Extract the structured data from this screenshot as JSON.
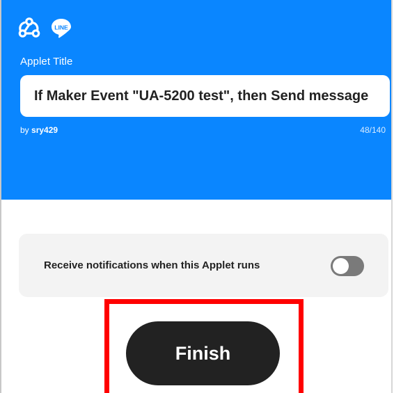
{
  "header": {
    "background_color": "#0a86ff",
    "service_icons": [
      "webhooks-icon",
      "line-icon"
    ],
    "line_icon_text": "LINE",
    "line_icon_color": "#ffffff"
  },
  "applet": {
    "title_label": "Applet Title",
    "title_value": "If Maker Event \"UA-5200 test\", then Send message",
    "author_prefix": "by",
    "author_name": "sry429",
    "char_count": "48/140"
  },
  "notifications": {
    "label": "Receive notifications when this Applet runs",
    "enabled": false
  },
  "actions": {
    "finish_label": "Finish",
    "highlight_color": "#ff0000"
  }
}
